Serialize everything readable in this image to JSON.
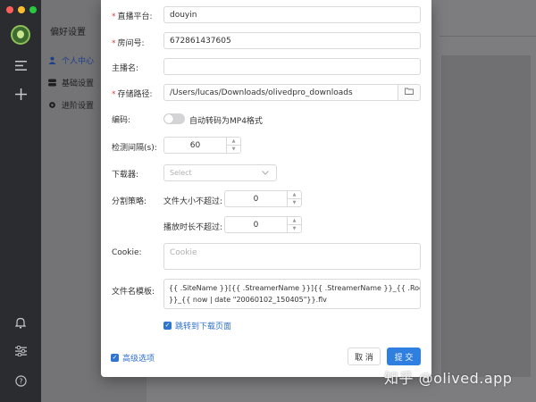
{
  "window": {
    "traffic_colors": [
      "#ff5f57",
      "#febc2e",
      "#28c840"
    ]
  },
  "rail": {
    "icons": [
      "app-logo",
      "menu-icon",
      "add-icon",
      "bell-icon",
      "sliders-icon",
      "help-icon"
    ]
  },
  "settings": {
    "title": "偏好设置",
    "items": [
      {
        "label": "个人中心",
        "icon": "user-icon",
        "active": true
      },
      {
        "label": "基础设置",
        "icon": "toggle-icon",
        "active": false
      },
      {
        "label": "进阶设置",
        "icon": "gear-icon",
        "active": false
      }
    ]
  },
  "form": {
    "platform": {
      "label": "直播平台:",
      "value": "douyin",
      "required": "*"
    },
    "room": {
      "label": "房间号:",
      "value": "672861437605",
      "required": "*"
    },
    "streamer": {
      "label": "主播名:",
      "value": ""
    },
    "storage": {
      "label": "存储路径:",
      "value": "/Users/lucas/Downloads/olivedpro_downloads",
      "required": "*"
    },
    "encoding": {
      "label": "编码:",
      "toggle_label": "自动转码为MP4格式",
      "enabled": false
    },
    "interval": {
      "label": "检测间隔(s):",
      "value": "60"
    },
    "downloader": {
      "label": "下载器:",
      "placeholder": "Select"
    },
    "split": {
      "label": "分割策略:",
      "size_label": "文件大小不超过:",
      "size_value": "0",
      "duration_label": "播放时长不超过:",
      "duration_value": "0"
    },
    "cookie": {
      "label": "Cookie:",
      "placeholder": "Cookie"
    },
    "filename": {
      "label": "文件名模板:",
      "line1": "{{ .SiteName }}[{{ .StreamerName }}]{{ .StreamerName }}_{{ .RoomName",
      "line2": "}}_{{ now | date \"20060102_150405\"}}.flv"
    },
    "jump": {
      "label": "跳转到下载页面",
      "checked": true
    }
  },
  "footer": {
    "advanced": {
      "label": "高级选项",
      "checked": true
    },
    "cancel": "取 消",
    "submit": "提 交"
  },
  "watermark": "知乎 @olived.app"
}
